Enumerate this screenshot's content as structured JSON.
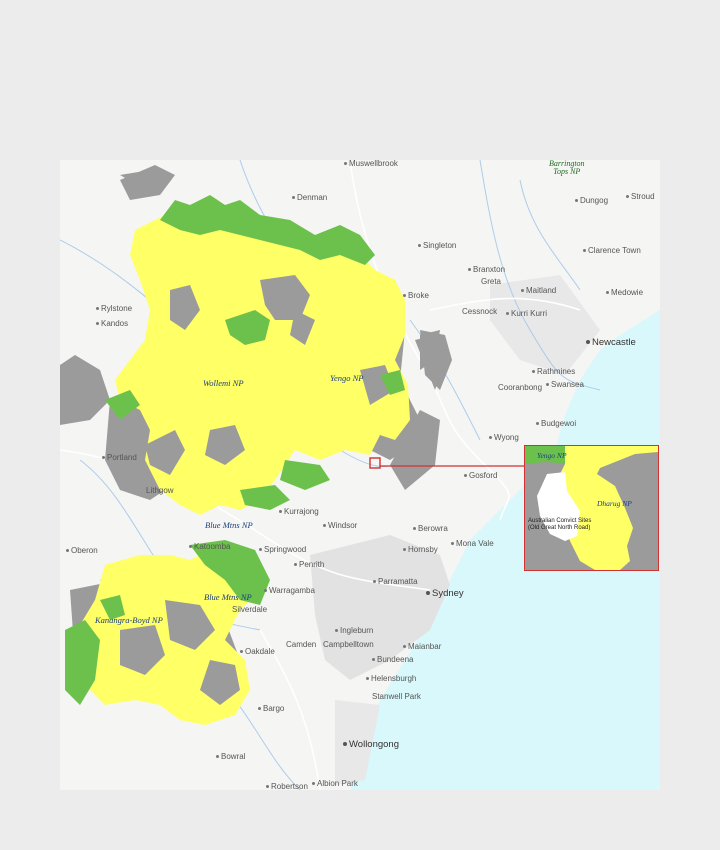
{
  "map": {
    "towns": [
      {
        "id": "muswellbrook",
        "label": "Muswellbrook"
      },
      {
        "id": "denman",
        "label": "Denman"
      },
      {
        "id": "dungog",
        "label": "Dungog"
      },
      {
        "id": "stroud",
        "label": "Stroud"
      },
      {
        "id": "singleton",
        "label": "Singleton"
      },
      {
        "id": "clarence-town",
        "label": "Clarence Town"
      },
      {
        "id": "branxton",
        "label": "Branxton"
      },
      {
        "id": "greta",
        "label": "Greta"
      },
      {
        "id": "maitland",
        "label": "Maitland"
      },
      {
        "id": "medowie",
        "label": "Medowie"
      },
      {
        "id": "broke",
        "label": "Broke"
      },
      {
        "id": "rylstone",
        "label": "Rylstone"
      },
      {
        "id": "kandos",
        "label": "Kandos"
      },
      {
        "id": "cessnock",
        "label": "Cessnock"
      },
      {
        "id": "kurri-kurri",
        "label": "Kurri Kurri"
      },
      {
        "id": "rathmines",
        "label": "Rathmines"
      },
      {
        "id": "cooranbong",
        "label": "Cooranbong"
      },
      {
        "id": "swansea",
        "label": "Swansea"
      },
      {
        "id": "budgewoi",
        "label": "Budgewoi"
      },
      {
        "id": "wyong",
        "label": "Wyong"
      },
      {
        "id": "portland",
        "label": "Portland"
      },
      {
        "id": "gosford",
        "label": "Gosford"
      },
      {
        "id": "lithgow",
        "label": "Lithgow"
      },
      {
        "id": "kurrajong",
        "label": "Kurrajong"
      },
      {
        "id": "windsor",
        "label": "Windsor"
      },
      {
        "id": "berowra",
        "label": "Berowra"
      },
      {
        "id": "mona-vale",
        "label": "Mona Vale"
      },
      {
        "id": "oberon",
        "label": "Oberon"
      },
      {
        "id": "katoomba",
        "label": "Katoomba"
      },
      {
        "id": "springwood",
        "label": "Springwood"
      },
      {
        "id": "hornsby",
        "label": "Hornsby"
      },
      {
        "id": "penrith",
        "label": "Penrith"
      },
      {
        "id": "parramatta",
        "label": "Parramatta"
      },
      {
        "id": "warragamba",
        "label": "Warragamba"
      },
      {
        "id": "silverdale",
        "label": "Silverdale"
      },
      {
        "id": "ingleburn",
        "label": "Ingleburn"
      },
      {
        "id": "oakdale",
        "label": "Oakdale"
      },
      {
        "id": "camden",
        "label": "Camden"
      },
      {
        "id": "campbelltown",
        "label": "Campbelltown"
      },
      {
        "id": "bundeena",
        "label": "Bundeena"
      },
      {
        "id": "maianbar",
        "label": "Maianbar"
      },
      {
        "id": "helensburgh",
        "label": "Helensburgh"
      },
      {
        "id": "bargo",
        "label": "Bargo"
      },
      {
        "id": "stanwell-park",
        "label": "Stanwell Park"
      },
      {
        "id": "bowral",
        "label": "Bowral"
      },
      {
        "id": "robertson",
        "label": "Robertson"
      },
      {
        "id": "albion-park",
        "label": "Albion Park"
      }
    ],
    "regions": [
      {
        "id": "newcastle",
        "label": "Newcastle"
      },
      {
        "id": "sydney",
        "label": "Sydney"
      },
      {
        "id": "wollongong",
        "label": "Wollongong"
      }
    ],
    "parks": [
      {
        "id": "wollemi",
        "label": "Wollemi NP"
      },
      {
        "id": "yengo",
        "label": "Yengo NP"
      },
      {
        "id": "blue-mtns-north",
        "label": "Blue Mtns NP"
      },
      {
        "id": "blue-mtns-south",
        "label": "Blue Mtns NP"
      },
      {
        "id": "kanangra-boyd",
        "label": "Kanangra-Boyd NP"
      },
      {
        "id": "barrington",
        "label": "Barrington\nTops NP"
      }
    ],
    "inset": {
      "yengo_label": "Yengo NP",
      "dharug_label": "Dharug NP",
      "road_label": "Australian Convict Sites\n(Old Great North Road)"
    },
    "colors": {
      "world_heritage_area": "#ffff66",
      "national_park_green": "#6cc14c",
      "other_reserve_grey": "#9b9b9b",
      "sea": "#d9f8fb",
      "urban": "#e4e4e4",
      "inset_border": "#d23232"
    }
  }
}
